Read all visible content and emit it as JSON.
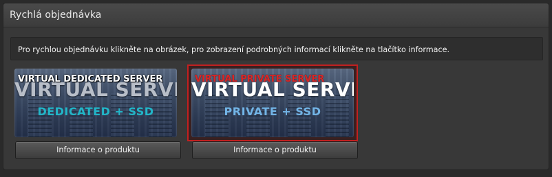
{
  "panel": {
    "title": "Rychlá objednávka",
    "info_text": "Pro rychlou objednávku klikněte na obrázek, pro zobrazení podrobných informací klikněte na tlačítko informace."
  },
  "products": [
    {
      "alt_text": "VIRTUAL DEDICATED SERVER",
      "headline": "VIRTUAL SERVER",
      "subline": "DEDICATED + SSD",
      "button_label": "Informace o produktu",
      "selected": false,
      "accent_color": "#22b6c8"
    },
    {
      "alt_text": "VIRTUAL PRIVATE SERVER",
      "headline": "VIRTUAL SERVER",
      "subline": "PRIVATE + SSD",
      "button_label": "Informace o produktu",
      "selected": true,
      "accent_color": "#72b4e6"
    }
  ],
  "colors": {
    "selection_border": "#c22020",
    "alt_text_selected": "#d92626"
  }
}
